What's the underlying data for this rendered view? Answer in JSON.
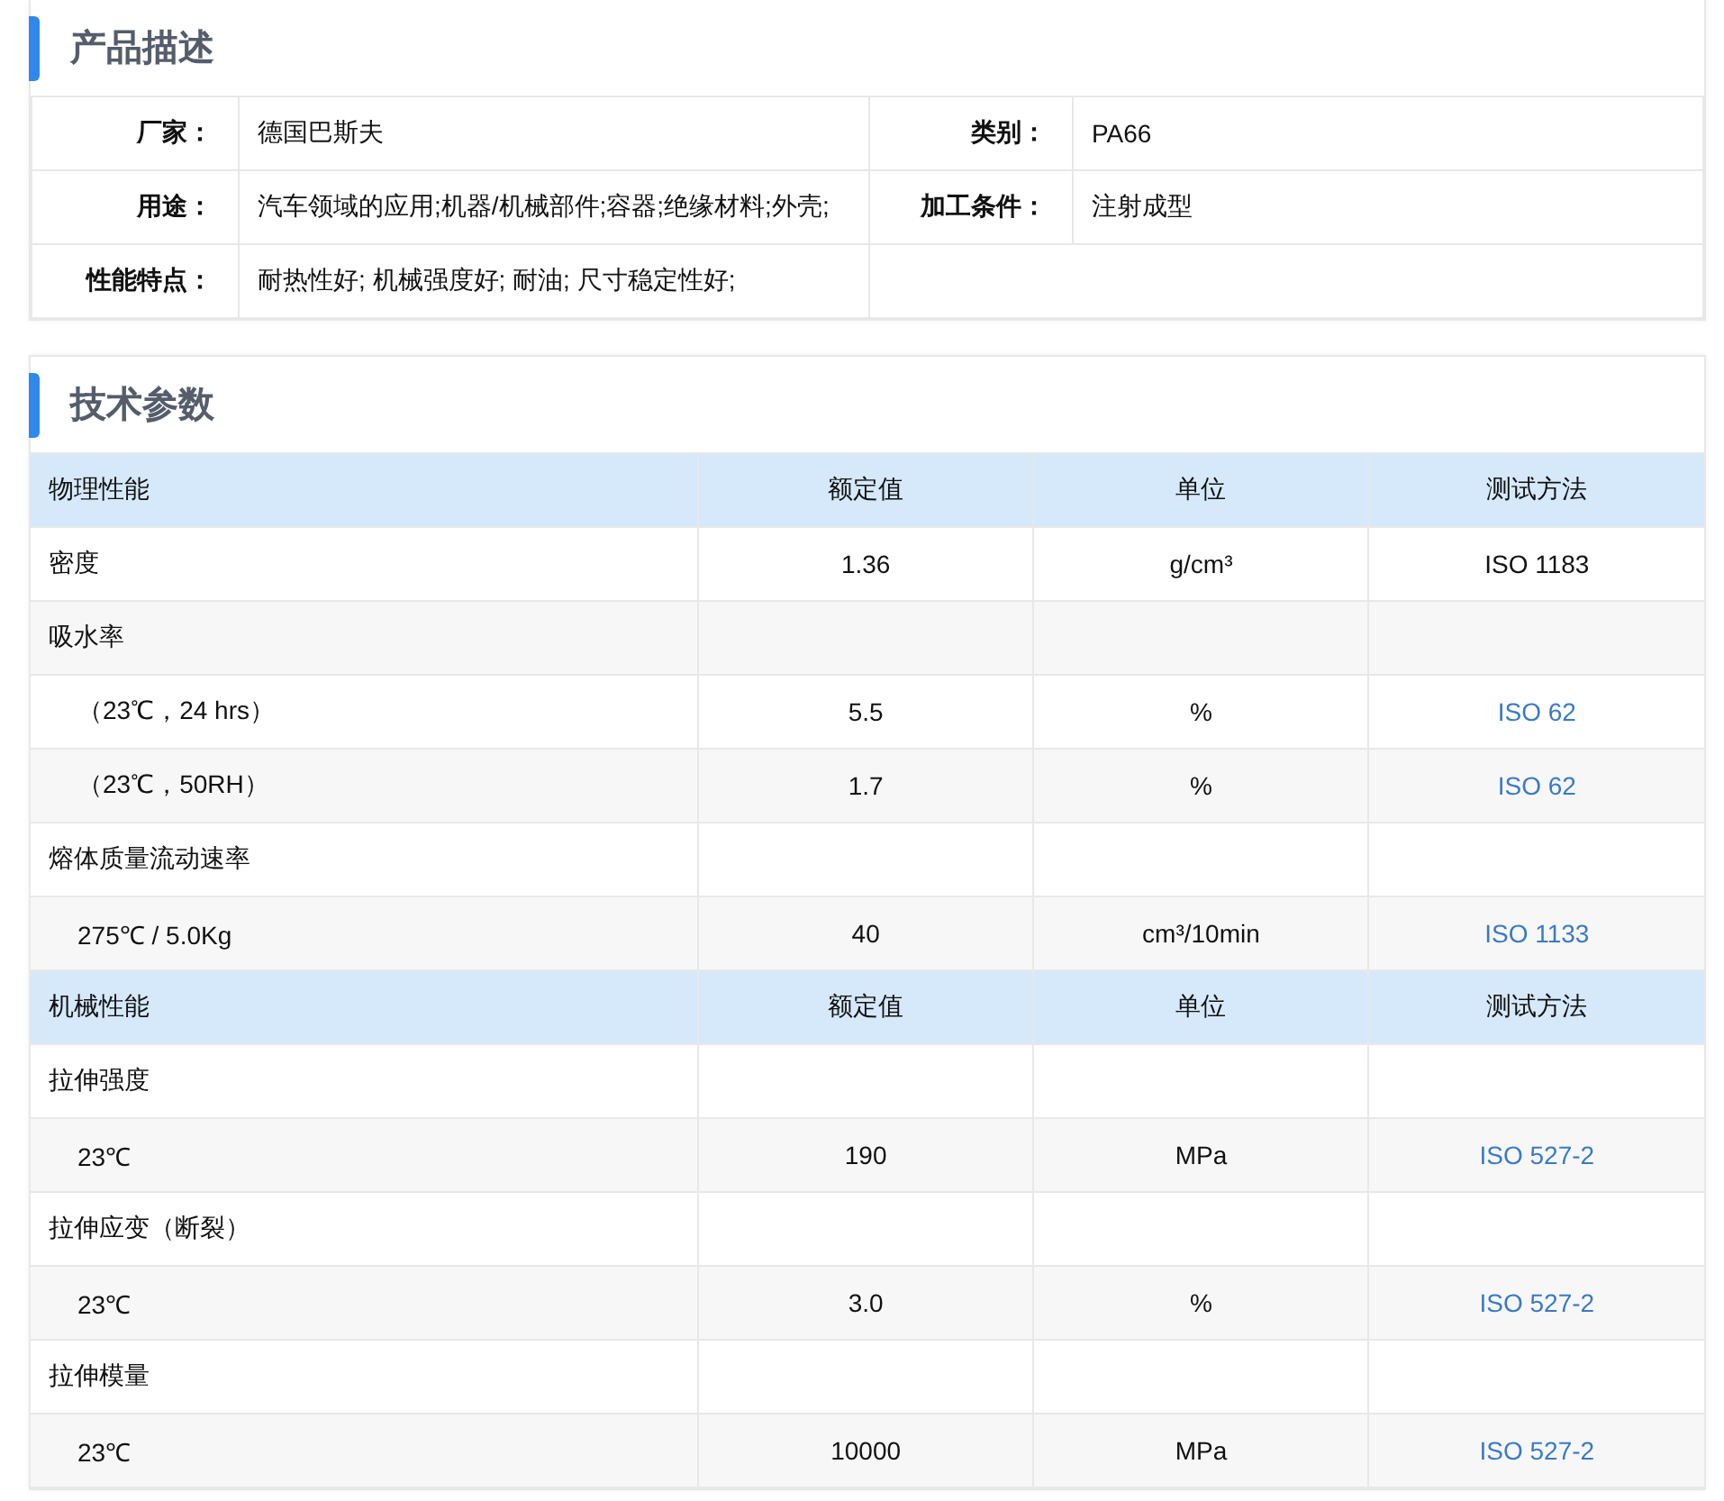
{
  "description": {
    "title": "产品描述",
    "rows": [
      [
        {
          "label": "厂家：",
          "value": "德国巴斯夫"
        },
        {
          "label": "类别：",
          "value": "PA66"
        }
      ],
      [
        {
          "label": "用途：",
          "value": "汽车领域的应用;机器/机械部件;容器;绝缘材料;外壳;"
        },
        {
          "label": "加工条件：",
          "value": "注射成型"
        }
      ],
      [
        {
          "label": "性能特点：",
          "value": "耐热性好; 机械强度好; 耐油; 尺寸稳定性好;"
        }
      ]
    ]
  },
  "parameters": {
    "title": "技术参数",
    "sections": [
      {
        "columns": [
          "物理性能",
          "额定值",
          "单位",
          "测试方法"
        ],
        "rows": [
          {
            "kind": "property",
            "name": "密度",
            "value": "1.36",
            "unit": "g/cm³",
            "method": "ISO 1183",
            "link": false
          },
          {
            "kind": "property",
            "name": "吸水率"
          },
          {
            "kind": "condition",
            "name": "（23℃，24 hrs）",
            "value": "5.5",
            "unit": "%",
            "method": "ISO 62",
            "link": true
          },
          {
            "kind": "condition",
            "name": "（23℃，50RH）",
            "value": "1.7",
            "unit": "%",
            "method": "ISO 62",
            "link": true
          },
          {
            "kind": "property",
            "name": "熔体质量流动速率"
          },
          {
            "kind": "condition",
            "name": "275℃ / 5.0Kg",
            "value": "40",
            "unit": "cm³/10min",
            "method": "ISO 1133",
            "link": true
          }
        ]
      },
      {
        "columns": [
          "机械性能",
          "额定值",
          "单位",
          "测试方法"
        ],
        "rows": [
          {
            "kind": "property",
            "name": "拉伸强度"
          },
          {
            "kind": "condition",
            "name": "23℃",
            "value": "190",
            "unit": "MPa",
            "method": "ISO 527-2",
            "link": true
          },
          {
            "kind": "property",
            "name": "拉伸应变（断裂）"
          },
          {
            "kind": "condition",
            "name": "23℃",
            "value": "3.0",
            "unit": "%",
            "method": "ISO 527-2",
            "link": true
          },
          {
            "kind": "property",
            "name": "拉伸模量"
          },
          {
            "kind": "condition",
            "name": "23℃",
            "value": "10000",
            "unit": "MPa",
            "method": "ISO 527-2",
            "link": true
          }
        ]
      }
    ]
  }
}
